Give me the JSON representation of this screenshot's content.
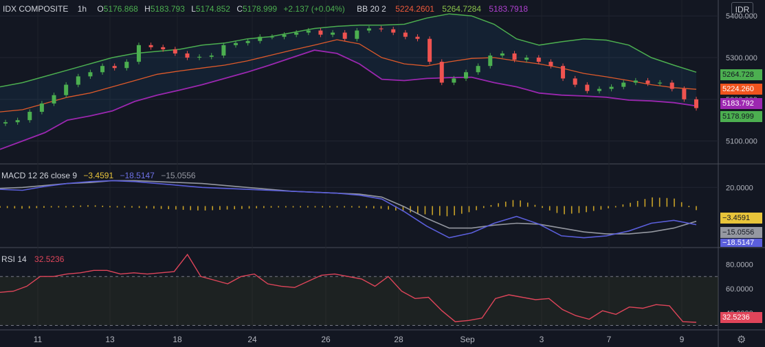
{
  "symbol": "IDX COMPOSITE",
  "interval": "1h",
  "ohlc": {
    "o_label": "O",
    "o": "5176.868",
    "h_label": "H",
    "h": "5183.793",
    "l_label": "L",
    "l": "5174.852",
    "c_label": "C",
    "c": "5178.999",
    "change": "+2.137 (+0.04%)"
  },
  "bb": {
    "label": "BB 20 2",
    "basis": "5224.2601",
    "upper": "5264.7284",
    "lower": "5183.7918"
  },
  "macd": {
    "label": "MACD 12 26 close 9",
    "hist": "−3.4591",
    "macd": "−18.5147",
    "signal": "−15.0556"
  },
  "rsi": {
    "label": "RSI 14",
    "value": "32.5236"
  },
  "currency": "IDR",
  "price_axis": [
    "5400.000",
    "5300.000",
    "5200.000",
    "5100.000"
  ],
  "macd_axis": [
    "20.0000"
  ],
  "rsi_axis": [
    "80.0000",
    "60.0000",
    "40.0000"
  ],
  "price_tags": {
    "upper": "5264.728",
    "basis": "5224.260",
    "lower": "5183.792",
    "close": "5178.999"
  },
  "macd_tags": {
    "hist": "−3.4591",
    "signal": "−15.0556",
    "macd": "−18.5147"
  },
  "rsi_tag": "32.5236",
  "x_axis": [
    "11",
    "13",
    "18",
    "24",
    "26",
    "28",
    "Sep",
    "3",
    "7",
    "9"
  ],
  "colors": {
    "bg": "#131722",
    "up": "#26a69a",
    "down": "#ef5350",
    "green": "#4caf50",
    "basis": "#e05a2a",
    "lower": "#9c27b0",
    "macd": "#5b5fdc",
    "signal": "#9598a1",
    "hist": "#c9a227",
    "rsi": "#e0455a"
  },
  "chart_data": [
    {
      "type": "candlestick",
      "title": "IDX COMPOSITE",
      "ylim": [
        5050,
        5430
      ],
      "x": [
        "11",
        "13",
        "18",
        "24",
        "26",
        "28",
        "Sep",
        "3",
        "7",
        "9"
      ],
      "close": [
        5145,
        5150,
        5170,
        5190,
        5210,
        5235,
        5255,
        5265,
        5280,
        5275,
        5290,
        5330,
        5325,
        5320,
        5310,
        5300,
        5302,
        5305,
        5330,
        5335,
        5340,
        5350,
        5350,
        5355,
        5360,
        5365,
        5355,
        5360,
        5345,
        5365,
        5370,
        5368,
        5360,
        5350,
        5345,
        5290,
        5240,
        5250,
        5265,
        5280,
        5305,
        5310,
        5295,
        5300,
        5290,
        5280,
        5250,
        5235,
        5220,
        5225,
        5230,
        5240,
        5245,
        5238,
        5240,
        5225,
        5200,
        5179
      ],
      "upper": [
        5230,
        5240,
        5255,
        5270,
        5285,
        5300,
        5310,
        5315,
        5320,
        5330,
        5335,
        5345,
        5350,
        5360,
        5370,
        5375,
        5378,
        5378,
        5380,
        5395,
        5405,
        5400,
        5380,
        5345,
        5330,
        5338,
        5345,
        5342,
        5330,
        5300,
        5282,
        5265
      ],
      "basis": [
        5170,
        5175,
        5190,
        5205,
        5215,
        5230,
        5245,
        5260,
        5268,
        5275,
        5282,
        5292,
        5305,
        5318,
        5330,
        5343,
        5333,
        5300,
        5285,
        5280,
        5290,
        5298,
        5300,
        5292,
        5285,
        5275,
        5262,
        5254,
        5245,
        5235,
        5228,
        5224
      ],
      "lower": [
        5080,
        5100,
        5120,
        5150,
        5160,
        5172,
        5195,
        5210,
        5222,
        5235,
        5250,
        5265,
        5282,
        5300,
        5318,
        5310,
        5285,
        5248,
        5245,
        5250,
        5252,
        5253,
        5240,
        5230,
        5215,
        5210,
        5208,
        5205,
        5198,
        5196,
        5192,
        5184
      ]
    },
    {
      "type": "line",
      "title": "MACD 12 26 close 9",
      "series": [
        {
          "name": "MACD",
          "values": [
            18,
            17,
            21,
            24,
            26,
            27,
            26,
            24,
            22,
            20,
            19,
            18,
            17,
            16,
            15,
            14,
            12,
            8,
            -5,
            -20,
            -32,
            -27,
            -17,
            -10,
            -18,
            -30,
            -32,
            -30,
            -25,
            -17,
            -14,
            -18.5
          ]
        },
        {
          "name": "Signal",
          "values": [
            19,
            20,
            22,
            24,
            25,
            27,
            27,
            26,
            25,
            24,
            22,
            20,
            18,
            16,
            15,
            14,
            13,
            10,
            0,
            -12,
            -22,
            -22,
            -19,
            -17,
            -18,
            -22,
            -26,
            -28,
            -28,
            -26,
            -22,
            -15
          ]
        },
        {
          "name": "Histogram",
          "values": [
            -1,
            -2,
            -1,
            0,
            1,
            0,
            -1,
            -2,
            -3,
            -4,
            -3,
            -2,
            -1,
            0,
            0,
            0,
            -1,
            -2,
            -5,
            -8,
            -10,
            -5,
            2,
            7,
            0,
            -8,
            -6,
            -2,
            3,
            9,
            8,
            -3.46
          ]
        }
      ]
    },
    {
      "type": "line",
      "title": "RSI 14",
      "ylim": [
        28,
        92
      ],
      "series": [
        {
          "name": "RSI",
          "values": [
            57,
            58,
            62,
            70,
            70,
            72,
            73,
            75,
            75,
            72,
            73,
            72,
            73,
            74,
            88,
            70,
            67,
            64,
            70,
            72,
            64,
            62,
            61,
            66,
            71,
            72,
            70,
            68,
            62,
            70,
            58,
            52,
            53,
            42,
            33,
            34,
            36,
            52,
            55,
            53,
            51,
            52,
            43,
            38,
            35,
            42,
            39,
            45,
            44,
            47,
            46,
            33,
            32.5
          ]
        }
      ]
    }
  ]
}
